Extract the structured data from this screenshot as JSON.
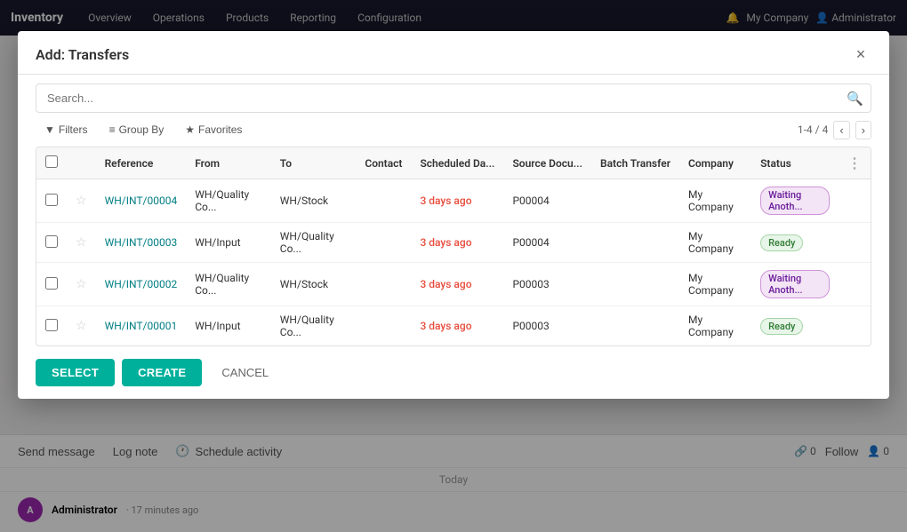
{
  "app": {
    "name": "Inventory",
    "nav_items": [
      "Overview",
      "Operations",
      "Products",
      "Reporting",
      "Configuration"
    ]
  },
  "dialog": {
    "title": "Add: Transfers",
    "close_label": "×"
  },
  "search": {
    "placeholder": "Search...",
    "search_icon": "🔍"
  },
  "toolbar": {
    "filters_label": "Filters",
    "groupby_label": "Group By",
    "favorites_label": "Favorites",
    "pagination": "1-4 / 4",
    "prev_icon": "‹",
    "next_icon": "›"
  },
  "table": {
    "headers": [
      "",
      "",
      "Reference",
      "From",
      "To",
      "Contact",
      "Scheduled Da...",
      "Source Docu...",
      "Batch Transfer",
      "Company",
      "Status",
      ""
    ],
    "rows": [
      {
        "id": "row1",
        "reference": "WH/INT/00004",
        "from": "WH/Quality Co...",
        "to": "WH/Stock",
        "contact": "",
        "scheduled_date": "3 days ago",
        "source_doc": "P00004",
        "batch_transfer": "",
        "company": "My Company",
        "status": "Waiting Anoth...",
        "status_type": "waiting"
      },
      {
        "id": "row2",
        "reference": "WH/INT/00003",
        "from": "WH/Input",
        "to": "WH/Quality Co...",
        "contact": "",
        "scheduled_date": "3 days ago",
        "source_doc": "P00004",
        "batch_transfer": "",
        "company": "My Company",
        "status": "Ready",
        "status_type": "ready"
      },
      {
        "id": "row3",
        "reference": "WH/INT/00002",
        "from": "WH/Quality Co...",
        "to": "WH/Stock",
        "contact": "",
        "scheduled_date": "3 days ago",
        "source_doc": "P00003",
        "batch_transfer": "",
        "company": "My Company",
        "status": "Waiting Anoth...",
        "status_type": "waiting"
      },
      {
        "id": "row4",
        "reference": "WH/INT/00001",
        "from": "WH/Input",
        "to": "WH/Quality Co...",
        "contact": "",
        "scheduled_date": "3 days ago",
        "source_doc": "P00003",
        "batch_transfer": "",
        "company": "My Company",
        "status": "Ready",
        "status_type": "ready"
      }
    ]
  },
  "footer": {
    "select_label": "SELECT",
    "create_label": "CREATE",
    "cancel_label": "CANCEL"
  },
  "bottom_bar": {
    "send_message": "Send message",
    "log_note": "Log note",
    "schedule_activity": "Schedule activity",
    "followers_count": "0",
    "follow_label": "Follow",
    "followers_icon_count": "0",
    "today_label": "Today",
    "admin_name": "Administrator",
    "admin_time": "· 17 minutes ago"
  }
}
